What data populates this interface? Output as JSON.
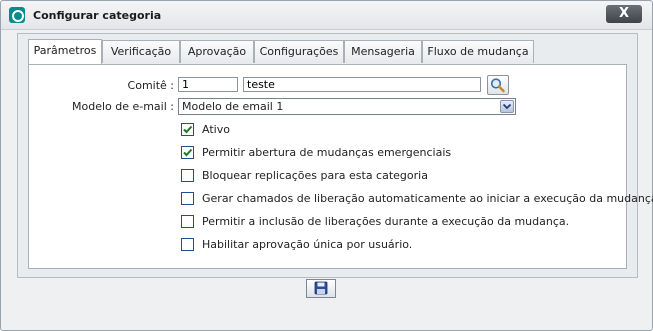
{
  "window": {
    "title": "Configurar categoria",
    "close_label": "X",
    "logo_icon": "app-logo-icon",
    "accent": "#0b8a8c"
  },
  "tabs": [
    {
      "label": "Parâmetros",
      "active": true
    },
    {
      "label": "Verificação",
      "active": false
    },
    {
      "label": "Aprovação",
      "active": false
    },
    {
      "label": "Configurações",
      "active": false
    },
    {
      "label": "Mensageria",
      "active": false
    },
    {
      "label": "Fluxo de mudança",
      "active": false
    }
  ],
  "form": {
    "comite_label": "Comitê :",
    "comite_id": "1",
    "comite_name": "teste",
    "modelo_label": "Modelo de e-mail :",
    "modelo_value": "Modelo de email 1"
  },
  "options": [
    {
      "label": "Ativo",
      "checked": true
    },
    {
      "label": "Permitir abertura de mudanças emergenciais",
      "checked": true
    },
    {
      "label": "Bloquear replicações para esta categoria",
      "checked": false
    },
    {
      "label": "Gerar chamados de liberação automaticamente ao iniciar a execução da mudança.",
      "checked": false
    },
    {
      "label": "Permitir a inclusão de liberações durante a execução da mudança.",
      "checked": false
    },
    {
      "label": "Habilitar aprovação única por usuário.",
      "checked": false
    }
  ],
  "actions": {
    "save_icon": "floppy-disk-icon"
  }
}
